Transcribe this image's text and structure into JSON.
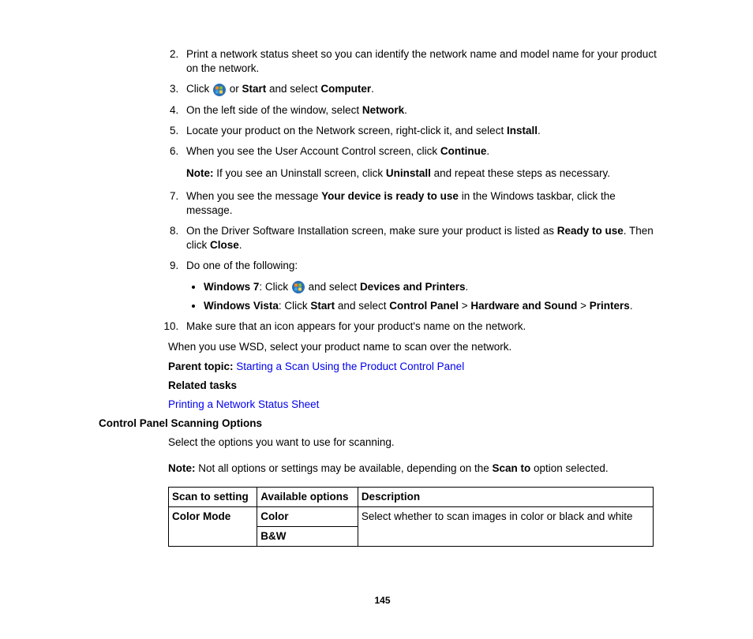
{
  "steps": {
    "s2": "Print a network status sheet so you can identify the network name and model name for your product on the network.",
    "s3_a": "Click ",
    "s3_b": " or ",
    "s3_c": "Start",
    "s3_d": " and select ",
    "s3_e": "Computer",
    "s3_f": ".",
    "s4_a": "On the left side of the window, select ",
    "s4_b": "Network",
    "s4_c": ".",
    "s5_a": "Locate your product on the Network screen, right-click it, and select ",
    "s5_b": "Install",
    "s5_c": ".",
    "s6_a": "When you see the User Account Control screen, click ",
    "s6_b": "Continue",
    "s6_c": ".",
    "note1_label": "Note:",
    "note1_a": " If you see an Uninstall screen, click ",
    "note1_b": "Uninstall",
    "note1_c": " and repeat these steps as necessary.",
    "s7_a": "When you see the message ",
    "s7_b": "Your device is ready to use",
    "s7_c": " in the Windows taskbar, click the message.",
    "s8_a": "On the Driver Software Installation screen, make sure your product is listed as ",
    "s8_b": "Ready to use",
    "s8_c": ". Then click ",
    "s8_d": "Close",
    "s8_e": ".",
    "s9": "Do one of the following:",
    "s9_w7_a": "Windows 7",
    "s9_w7_b": ": Click ",
    "s9_w7_c": " and select ",
    "s9_w7_d": "Devices and Printers",
    "s9_w7_e": ".",
    "s9_wv_a": "Windows Vista",
    "s9_wv_b": ": Click ",
    "s9_wv_c": "Start",
    "s9_wv_d": " and select ",
    "s9_wv_e": "Control Panel",
    "s9_wv_f": " > ",
    "s9_wv_g": "Hardware and Sound",
    "s9_wv_h": " > ",
    "s9_wv_i": "Printers",
    "s9_wv_j": ".",
    "s10": "Make sure that an icon appears for your product's name on the network."
  },
  "after": {
    "wsd": "When you use WSD, select your product name to scan over the network.",
    "parent_label": "Parent topic:",
    "parent_link": "Starting a Scan Using the Product Control Panel",
    "related_label": "Related tasks",
    "related_link": "Printing a Network Status Sheet"
  },
  "section": {
    "heading": "Control Panel Scanning Options",
    "intro": "Select the options you want to use for scanning.",
    "note_label": "Note:",
    "note_a": " Not all options or settings may be available, depending on the ",
    "note_b": "Scan to",
    "note_c": " option selected."
  },
  "table": {
    "h1": "Scan to setting",
    "h2": "Available options",
    "h3": "Description",
    "r1c1": "Color Mode",
    "r1c2": "Color",
    "r2c2": "B&W",
    "r1c3": "Select whether to scan images in color or black and white"
  },
  "page_number": "145"
}
